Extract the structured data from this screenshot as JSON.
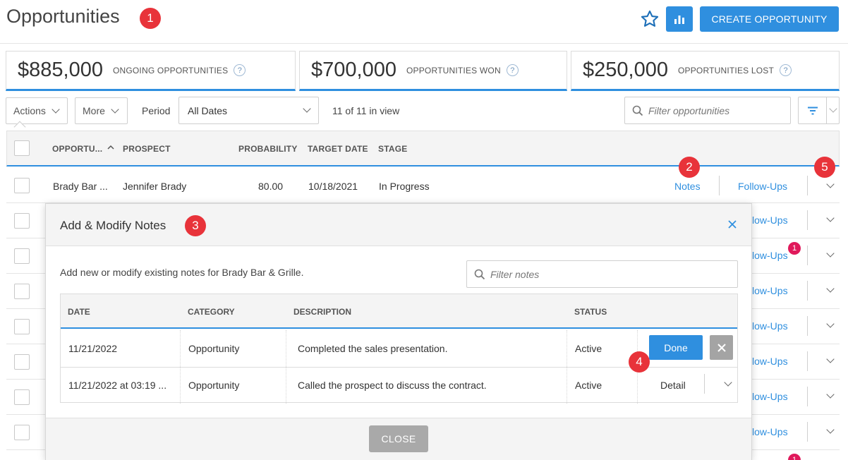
{
  "header": {
    "title": "Opportunities",
    "create_label": "CREATE OPPORTUNITY",
    "accent": "#2f8fdf"
  },
  "callouts": [
    "1",
    "2",
    "3",
    "4",
    "5"
  ],
  "stats": [
    {
      "amount": "$885,000",
      "label": "ONGOING OPPORTUNITIES"
    },
    {
      "amount": "$700,000",
      "label": "OPPORTUNITIES WON"
    },
    {
      "amount": "$250,000",
      "label": "OPPORTUNITIES LOST"
    }
  ],
  "toolbar": {
    "actions_label": "Actions",
    "more_label": "More",
    "period_label": "Period",
    "period_value": "All Dates",
    "in_view": "11 of 11 in view",
    "filter_placeholder": "Filter opportunities"
  },
  "grid": {
    "columns": {
      "opportunity": "OPPORTU...",
      "prospect": "PROSPECT",
      "probability": "PROBABILITY",
      "target_date": "TARGET DATE",
      "stage": "STAGE"
    },
    "first_row": {
      "opportunity": "Brady Bar ...",
      "prospect": "Jennifer Brady",
      "probability": "80.00",
      "target_date": "10/18/2021",
      "stage": "In Progress"
    },
    "notes_label": "Notes",
    "followups_label": "Follow-Ups",
    "followups_partial": "low-Ups",
    "followups_badge": "1"
  },
  "modal": {
    "title": "Add & Modify Notes",
    "description": "Add new or modify existing notes for Brady Bar & Grille.",
    "filter_placeholder": "Filter notes",
    "columns": {
      "date": "DATE",
      "category": "CATEGORY",
      "description": "DESCRIPTION",
      "status": "STATUS"
    },
    "rows": [
      {
        "date": "11/21/2022",
        "category": "Opportunity",
        "description": "Completed the sales presentation.",
        "status": "Active"
      },
      {
        "date": "11/21/2022 at 03:19 ...",
        "category": "Opportunity",
        "description": "Called the prospect to discuss the contract.",
        "status": "Active"
      }
    ],
    "done_label": "Done",
    "detail_label": "Detail",
    "close_label": "CLOSE"
  }
}
